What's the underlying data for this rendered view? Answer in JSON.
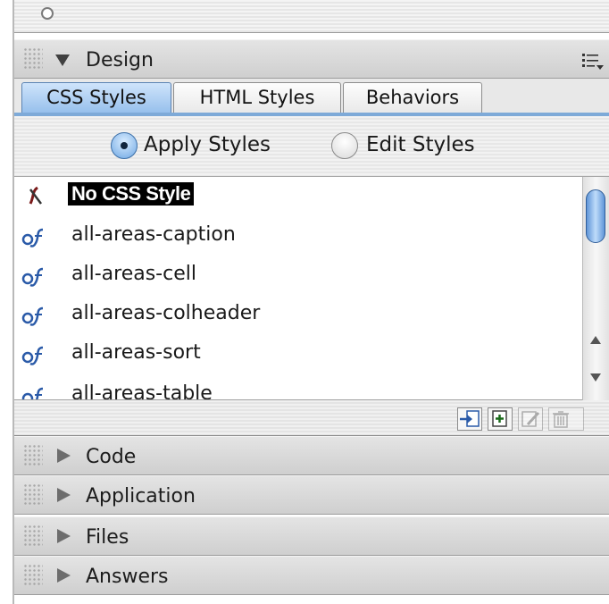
{
  "design_panel": {
    "title": "Design",
    "tabs": [
      {
        "label": "CSS Styles",
        "active": true
      },
      {
        "label": "HTML Styles",
        "active": false
      },
      {
        "label": "Behaviors",
        "active": false
      }
    ],
    "radio_options": [
      {
        "label": "Apply Styles",
        "checked": true
      },
      {
        "label": "Edit Styles",
        "checked": false
      }
    ],
    "styles": [
      {
        "label": "No CSS Style",
        "selected": true,
        "icon": "no-style-icon"
      },
      {
        "label": "all-areas-caption",
        "selected": false,
        "icon": "css-style-icon"
      },
      {
        "label": "all-areas-cell",
        "selected": false,
        "icon": "css-style-icon"
      },
      {
        "label": "all-areas-colheader",
        "selected": false,
        "icon": "css-style-icon"
      },
      {
        "label": "all-areas-sort",
        "selected": false,
        "icon": "css-style-icon"
      },
      {
        "label": "all-areas-table",
        "selected": false,
        "icon": "css-style-icon"
      }
    ],
    "footer_tools": [
      "attach-stylesheet-icon",
      "new-style-icon",
      "edit-style-icon",
      "delete-style-icon"
    ]
  },
  "collapsed_panels": [
    {
      "title": "Code"
    },
    {
      "title": "Application"
    },
    {
      "title": "Files"
    },
    {
      "title": "Answers"
    }
  ],
  "colors": {
    "accent_blue": "#7eaad8",
    "selection": "#000000",
    "icon_blue": "#2a5aa8"
  }
}
